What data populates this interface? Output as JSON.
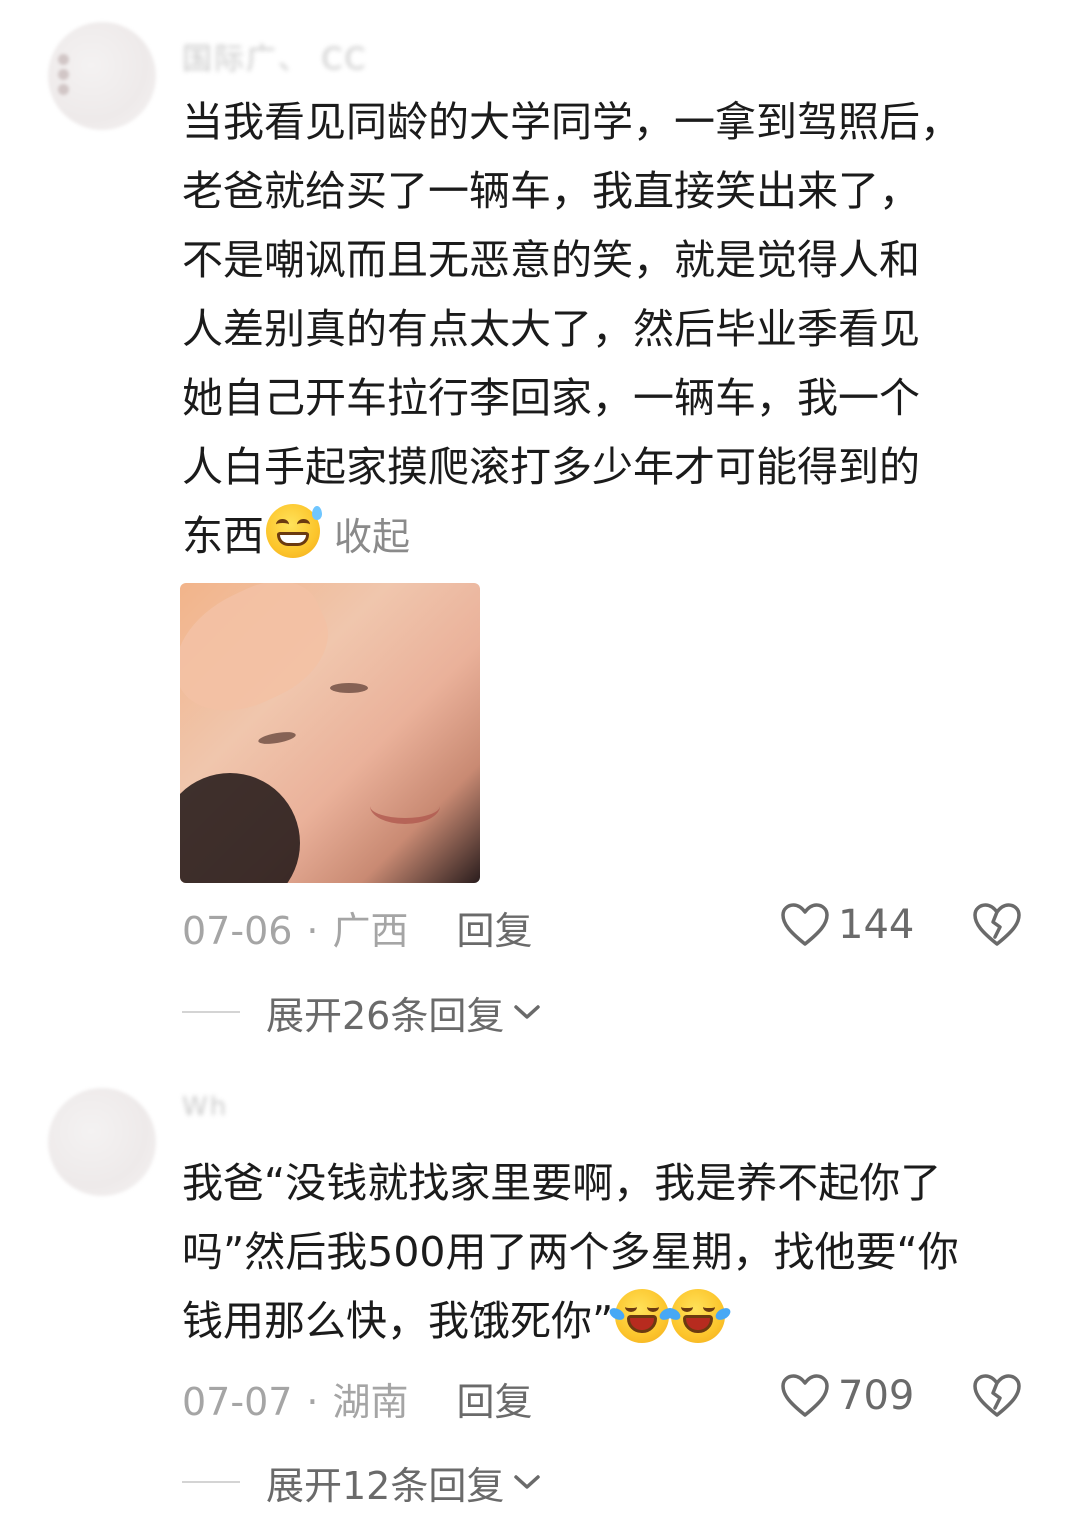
{
  "comments": [
    {
      "username": "国际广、 CC",
      "lines": [
        "当我看见同龄的大学同学，一拿到驾照后，",
        "老爸就给买了一辆车，我直接笑出来了，",
        "不是嘲讽而且无恶意的笑，就是觉得人和",
        "人差别真的有点太大了，然后毕业季看见",
        "她自己开车拉行李回家，一辆车，我一个",
        "人白手起家摸爬滚打多少年才可能得到的",
        "东西"
      ],
      "emoji": "grinning-sweat-emoji",
      "collapse_label": "收起",
      "has_photo": true,
      "date": "07-06",
      "dot": "·",
      "location": "广西",
      "reply_label": "回复",
      "likes": "144",
      "expand_label": "展开26条回复"
    },
    {
      "username": "Wh",
      "lines": [
        "我爸“没钱就找家里要啊，我是养不起你了",
        "吗”然后我500用了两个多星期，找他要“你",
        "钱用那么快，我饿死你”"
      ],
      "emoji": "laughing-crying-emoji",
      "date": "07-07",
      "dot": "·",
      "location": "湖南",
      "reply_label": "回复",
      "likes": "709",
      "expand_label": "展开12条回复"
    }
  ],
  "colors": {
    "text": "#1b1b1b",
    "meta": "#a5a5a5",
    "action": "#6a6a6a"
  }
}
